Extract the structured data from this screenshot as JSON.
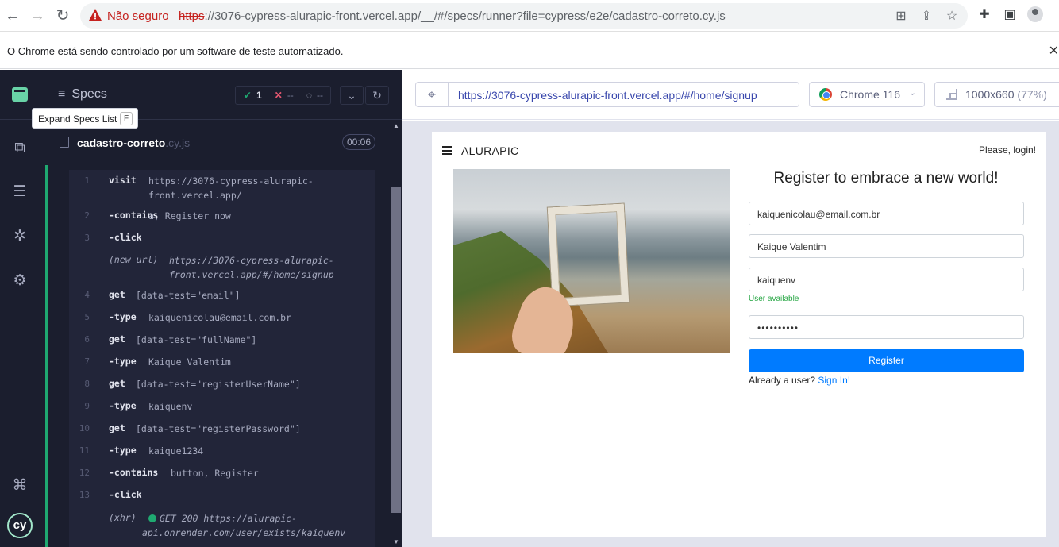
{
  "browser": {
    "not_secure": "Não seguro",
    "url_scheme": "https",
    "url_rest": "://3076-cypress-alurapic-front.vercel.app/__/#/specs/runner?file=cypress/e2e/cadastro-correto.cy.js",
    "automation_notice": "O Chrome está sendo controlado por um software de teste automatizado."
  },
  "reporter": {
    "specs_label": "Specs",
    "tooltip": "Expand Specs List",
    "tooltip_key": "F",
    "stats": {
      "passed": "1",
      "failed": "--",
      "pending": "--"
    },
    "spec_name": "cadastro-correto",
    "spec_ext": ".cy.js",
    "duration": "00:06",
    "commands": [
      {
        "num": "1",
        "name": "visit",
        "msg": "https://3076-cypress-alurapic-front.vercel.app/"
      },
      {
        "num": "2",
        "name": "-contains",
        "msg": "a, Register now"
      },
      {
        "num": "3",
        "name": "-click",
        "msg": ""
      },
      {
        "num": "",
        "name": "(new url)",
        "msg": "https://3076-cypress-alurapic-front.vercel.app/#/home/signup"
      },
      {
        "num": "4",
        "name": "get",
        "msg": "[data-test=\"email\"]"
      },
      {
        "num": "5",
        "name": "-type",
        "msg": "kaiquenicolau@email.com.br"
      },
      {
        "num": "6",
        "name": "get",
        "msg": "[data-test=\"fullName\"]"
      },
      {
        "num": "7",
        "name": "-type",
        "msg": "Kaique Valentim"
      },
      {
        "num": "8",
        "name": "get",
        "msg": "[data-test=\"registerUserName\"]"
      },
      {
        "num": "9",
        "name": "-type",
        "msg": "kaiquenv"
      },
      {
        "num": "10",
        "name": "get",
        "msg": "[data-test=\"registerPassword\"]"
      },
      {
        "num": "11",
        "name": "-type",
        "msg": "kaique1234"
      },
      {
        "num": "12",
        "name": "-contains",
        "msg": "button, Register"
      },
      {
        "num": "13",
        "name": "-click",
        "msg": ""
      },
      {
        "num": "",
        "name": "(xhr)",
        "method": "GET 200",
        "msg": "https://alurapic-api.onrender.com/user/exists/kaiquenv"
      }
    ]
  },
  "aut": {
    "url": "https://3076-cypress-alurapic-front.vercel.app/#/home/signup",
    "browser": "Chrome 116",
    "viewport": "1000x660",
    "zoom": "(77%)"
  },
  "app": {
    "brand": "ALURAPIC",
    "login_prompt": "Please, login!",
    "title": "Register to embrace a new world!",
    "email": "kaiquenicolau@email.com.br",
    "full_name": "Kaique Valentim",
    "username": "kaiquenv",
    "username_status": "User available",
    "password_mask": "••••••••••",
    "register_label": "Register",
    "already_text": "Already a user?",
    "signin_link": "Sign In!"
  },
  "colors": {
    "accent_green": "#1fa971",
    "primary_blue": "#007bff",
    "danger_red": "#c5221f"
  }
}
